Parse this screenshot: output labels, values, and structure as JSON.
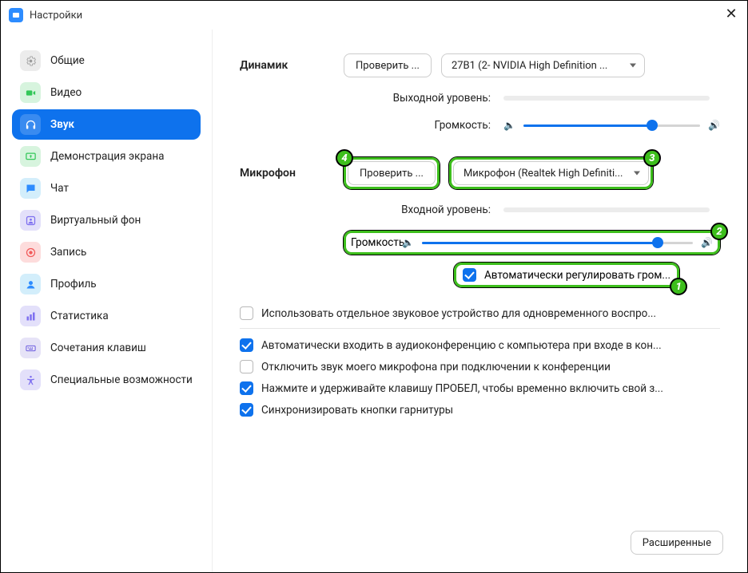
{
  "window": {
    "title": "Настройки",
    "close_glyph": "✕"
  },
  "sidebar": {
    "items": [
      {
        "key": "general",
        "label": "Общие"
      },
      {
        "key": "video",
        "label": "Видео"
      },
      {
        "key": "audio",
        "label": "Звук"
      },
      {
        "key": "share",
        "label": "Демонстрация экрана"
      },
      {
        "key": "chat",
        "label": "Чат"
      },
      {
        "key": "virtual",
        "label": "Виртуальный фон"
      },
      {
        "key": "record",
        "label": "Запись"
      },
      {
        "key": "profile",
        "label": "Профиль"
      },
      {
        "key": "stats",
        "label": "Статистика"
      },
      {
        "key": "keys",
        "label": "Сочетания клавиш"
      },
      {
        "key": "access",
        "label": "Специальные возможности"
      }
    ],
    "active_index": 2
  },
  "speaker": {
    "section_label": "Динамик",
    "test_label": "Проверить ...",
    "device": "27B1 (2- NVIDIA High Definition ...",
    "output_level_label": "Выходной уровень:",
    "volume_label": "Громкость:",
    "volume_percent": 73
  },
  "microphone": {
    "section_label": "Микрофон",
    "test_label": "Проверить ...",
    "device": "Микрофон (Realtek High Definiti...",
    "input_level_label": "Входной уровень:",
    "volume_label": "Громкость:",
    "volume_percent": 87,
    "auto_adjust_label": "Автоматически регулировать гром...",
    "auto_adjust_checked": true
  },
  "options": {
    "separate_device": {
      "checked": false,
      "label": "Использовать отдельное звуковое устройство для одновременного воспро..."
    },
    "auto_join": {
      "checked": true,
      "label": "Автоматически входить в аудиоконференцию с компьютера при входе в кон..."
    },
    "mute_on_join": {
      "checked": false,
      "label": "Отключить звук моего микрофона при подключении к конференции"
    },
    "push_to_talk": {
      "checked": true,
      "label": "Нажмите и удерживайте клавишу ПРОБЕЛ, чтобы временно включить свой з..."
    },
    "sync_headset": {
      "checked": true,
      "label": "Синхронизировать кнопки гарнитуры"
    }
  },
  "advanced_label": "Расширенные",
  "badges": {
    "one": "1",
    "two": "2",
    "three": "3",
    "four": "4"
  }
}
